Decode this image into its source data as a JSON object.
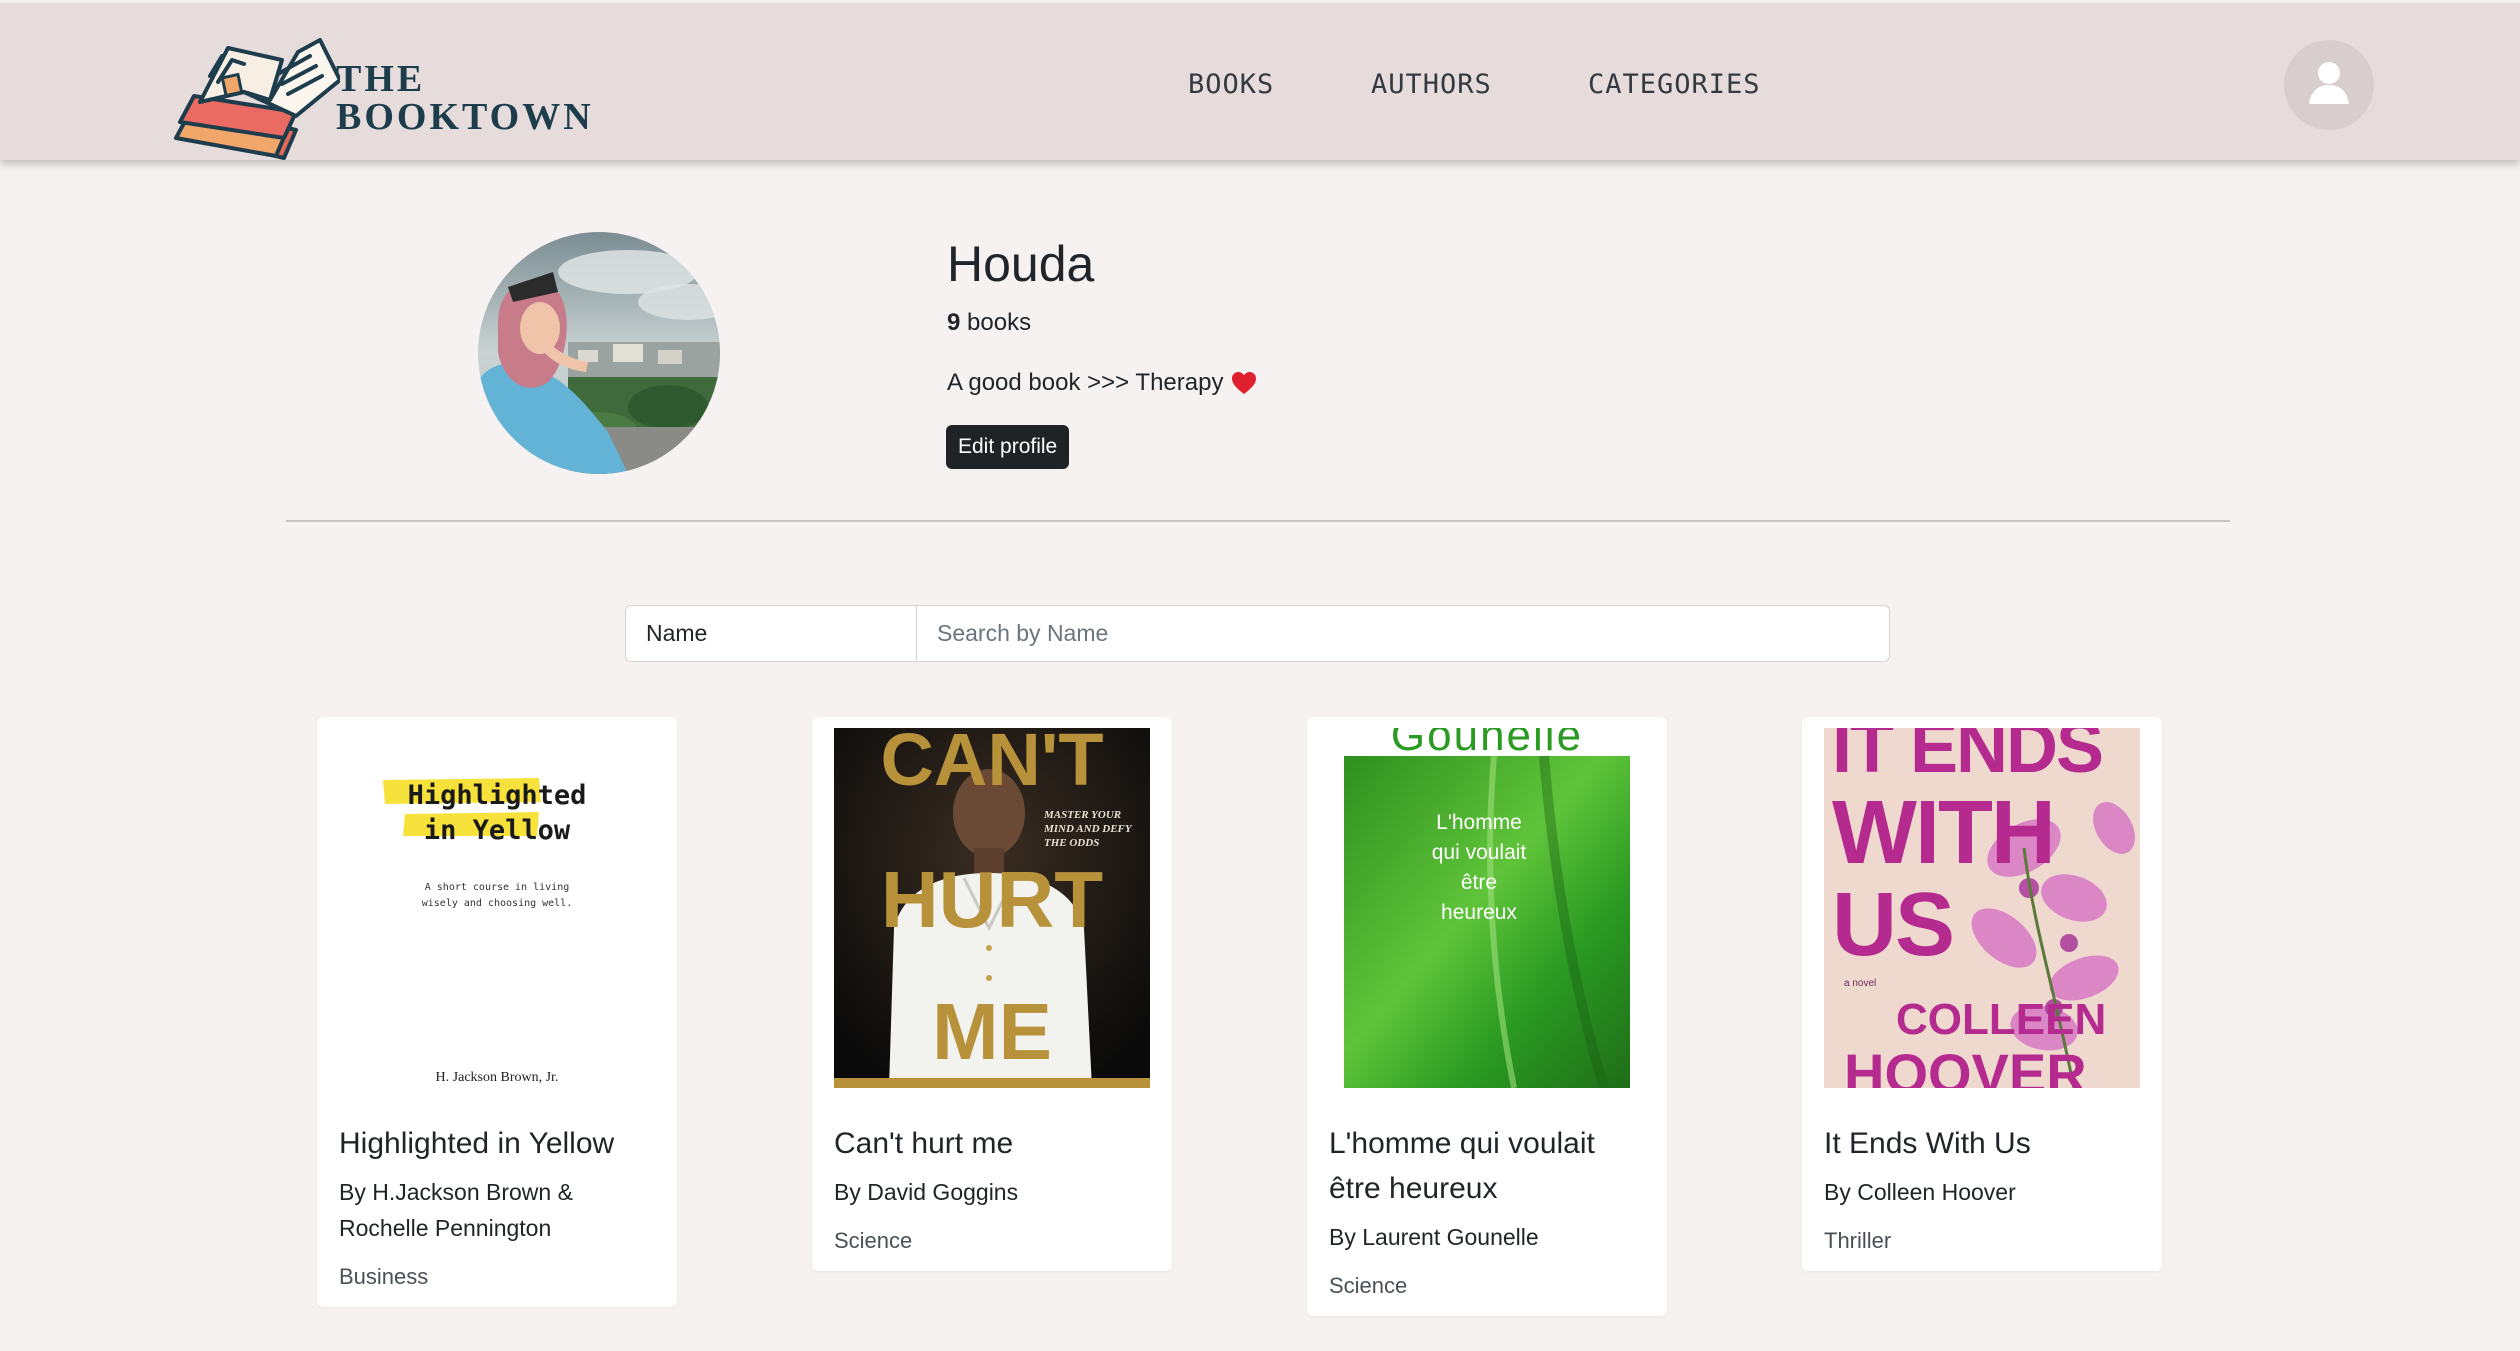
{
  "header": {
    "logo_line1": "THE",
    "logo_line2": "BOOKTOWN",
    "nav": [
      "BOOKS",
      "AUTHORS",
      "CATEGORIES"
    ]
  },
  "profile": {
    "name": "Houda",
    "book_count": "9",
    "book_count_label": " books",
    "bio": "A good book >>> Therapy",
    "edit_button": "Edit profile"
  },
  "search": {
    "field_selected": "Name",
    "placeholder": "Search by Name"
  },
  "books": [
    {
      "title": "Highlighted in Yellow",
      "author": "By H.Jackson Brown & Rochelle Pennington",
      "category": "Business",
      "cover": {
        "line1": "Highlighted",
        "line2": "in Yellow",
        "tagline": "A short course in living wisely and choosing well.",
        "byline": "H. Jackson Brown, Jr."
      }
    },
    {
      "title": "Can't hurt me",
      "author": "By David Goggins",
      "category": "Science",
      "cover": {
        "w1": "CAN'T",
        "w2": "HURT",
        "w3": "ME",
        "tagline": "MASTER YOUR MIND AND DEFY THE ODDS"
      }
    },
    {
      "title": "L'homme qui voulait être heureux",
      "author": "By Laurent Gounelle",
      "category": "Science",
      "cover": {
        "top": "Gounelle",
        "text": "L'homme qui voulait être heureux"
      }
    },
    {
      "title": "It Ends With Us",
      "author": "By Colleen Hoover",
      "category": "Thriller",
      "cover": {
        "w1": "IT ENDS",
        "w2": "WITH",
        "w3": "US",
        "novel": "a novel",
        "a1": "COLLEEN",
        "a2": "HOOVER"
      }
    }
  ]
}
